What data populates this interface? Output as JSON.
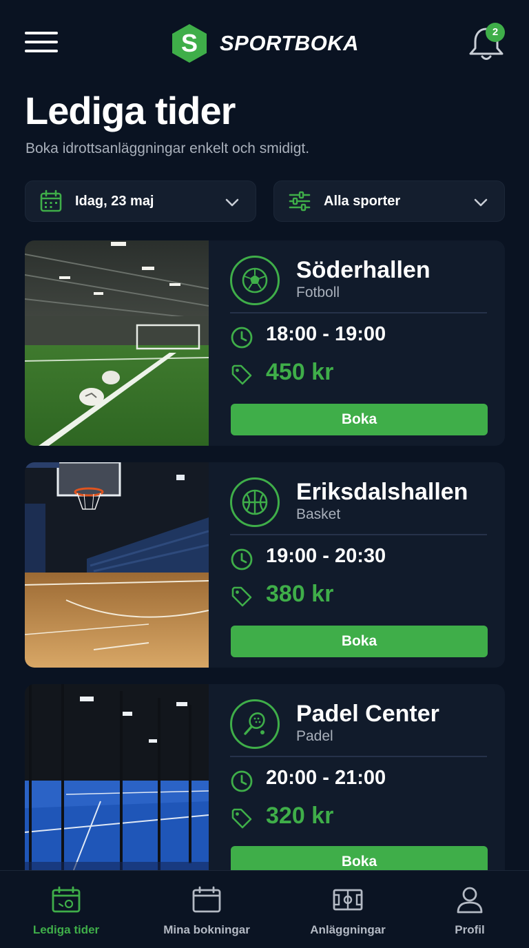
{
  "app": {
    "brand_name": "SPORTBOKA",
    "logo_letter": "S",
    "notification_count": "2",
    "accent_color": "#3fae49"
  },
  "page": {
    "title": "Lediga tider",
    "subtitle": "Boka idrottsanläggningar enkelt och smidigt."
  },
  "filters": {
    "date_label": "Idag, 23 maj",
    "sport_label": "Alla sporter"
  },
  "listings": [
    {
      "venue": "Söderhallen",
      "sport": "Fotboll",
      "time": "18:00 - 19:00",
      "price": "450 kr",
      "button": "Boka",
      "icon": "football-icon"
    },
    {
      "venue": "Eriksdalshallen",
      "sport": "Basket",
      "time": "19:00 - 20:30",
      "price": "380 kr",
      "button": "Boka",
      "icon": "basketball-icon"
    },
    {
      "venue": "Padel Center",
      "sport": "Padel",
      "time": "20:00 - 21:00",
      "price": "320 kr",
      "button": "Boka",
      "icon": "padel-racket-icon"
    }
  ],
  "bottom_nav": [
    {
      "label": "Lediga tider",
      "icon": "calendar-icon",
      "active": true
    },
    {
      "label": "Mina bokningar",
      "icon": "calendar-blank-icon",
      "active": false
    },
    {
      "label": "Anläggningar",
      "icon": "court-icon",
      "active": false
    },
    {
      "label": "Profil",
      "icon": "user-icon",
      "active": false
    }
  ]
}
